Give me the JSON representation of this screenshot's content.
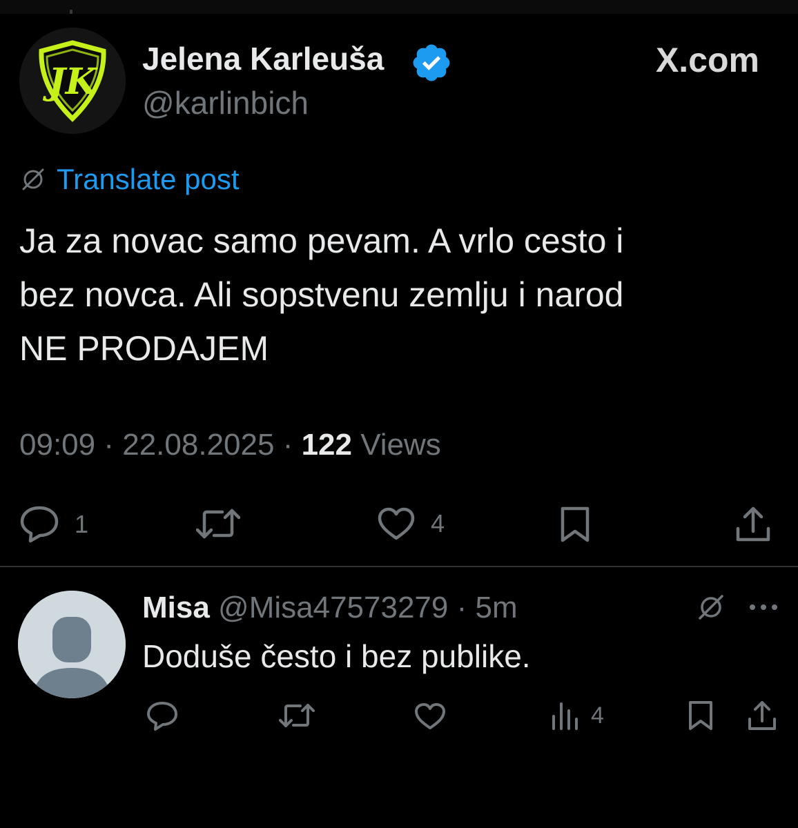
{
  "post": {
    "author_name": "Jelena Karleuša",
    "handle": "@karlinbich",
    "source_brand": "X.com",
    "translate_label": "Translate post",
    "text_lines": [
      "Ja za novac samo pevam. A vrlo cesto i",
      "bez novca. Ali sopstvenu zemlju i narod",
      "NE PRODAJEM"
    ],
    "time": "09:09",
    "date": "22.08.2025",
    "views_count": "122",
    "views_label": "Views",
    "separator": "·",
    "actions": {
      "reply_count": "1",
      "like_count": "4"
    },
    "avatar_monogram": "JK"
  },
  "reply": {
    "name": "Misa",
    "handle": "@Misa47573279",
    "age": "5m",
    "separator": "·",
    "text": "Doduše često i bez publike.",
    "views_count": "4"
  },
  "colors": {
    "background": "#000000",
    "text_primary": "#e7e9ea",
    "text_secondary": "#71767b",
    "link": "#1d9bf0",
    "verified": "#1d9bf0",
    "divider": "#2f3336",
    "avatar_accent": "#c6f01a"
  },
  "icons": {
    "verified": "verified-badge-icon",
    "translate": "globe-icon",
    "reply": "reply-icon",
    "repost": "repost-icon",
    "like": "like-icon",
    "bookmark": "bookmark-icon",
    "share": "share-icon",
    "views": "views-icon",
    "more": "more-icon"
  }
}
